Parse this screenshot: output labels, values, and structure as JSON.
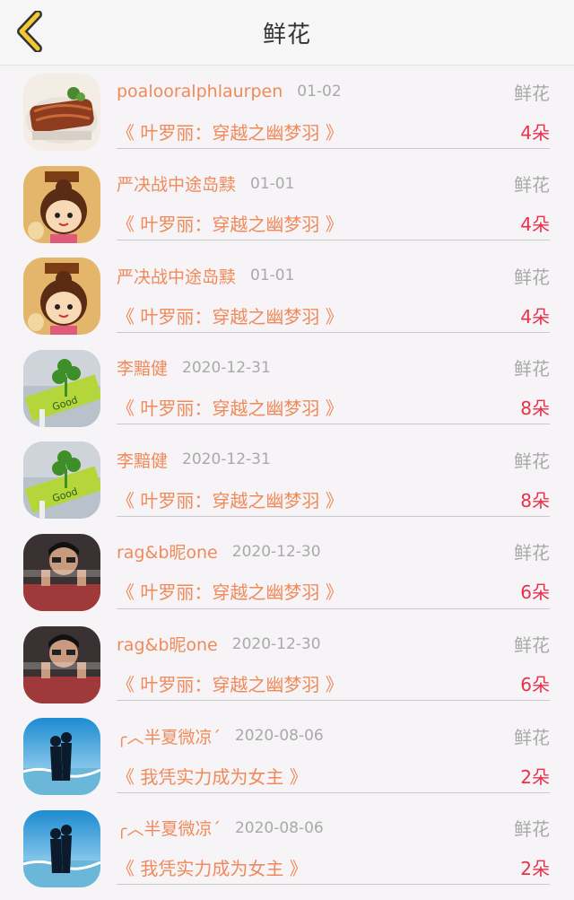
{
  "header": {
    "title": "鲜花",
    "back_icon": "chevron-left-icon",
    "accent": "#f3c832"
  },
  "colors": {
    "name": "#f08a5b",
    "date": "#a9a9a9",
    "count": "#e8304a"
  },
  "rows": [
    {
      "avatar": "food",
      "username": "poalooralphlaurpen",
      "date": "01-02",
      "type": "鲜花",
      "book": "《 叶罗丽：穿越之幽梦羽 》",
      "count": "4朵"
    },
    {
      "avatar": "cartoon-girl",
      "username": "严决战中途岛黩",
      "date": "01-01",
      "type": "鲜花",
      "book": "《 叶罗丽：穿越之幽梦羽 》",
      "count": "4朵"
    },
    {
      "avatar": "cartoon-girl",
      "username": "严决战中途岛黩",
      "date": "01-01",
      "type": "鲜花",
      "book": "《 叶罗丽：穿越之幽梦羽 》",
      "count": "4朵"
    },
    {
      "avatar": "clover",
      "username": "李黯健",
      "date": "2020-12-31",
      "type": "鲜花",
      "book": "《 叶罗丽：穿越之幽梦羽 》",
      "count": "8朵"
    },
    {
      "avatar": "clover",
      "username": "李黯健",
      "date": "2020-12-31",
      "type": "鲜花",
      "book": "《 叶罗丽：穿越之幽梦羽 》",
      "count": "8朵"
    },
    {
      "avatar": "boy",
      "username": "rag&b昵one",
      "date": "2020-12-30",
      "type": "鲜花",
      "book": "《 叶罗丽：穿越之幽梦羽 》",
      "count": "6朵"
    },
    {
      "avatar": "boy",
      "username": "rag&b昵one",
      "date": "2020-12-30",
      "type": "鲜花",
      "book": "《 叶罗丽：穿越之幽梦羽 》",
      "count": "6朵"
    },
    {
      "avatar": "couple",
      "username": "╭︿半夏微凉΄",
      "date": "2020-08-06",
      "type": "鲜花",
      "book": "《 我凭实力成为女主 》",
      "count": "2朵"
    },
    {
      "avatar": "couple",
      "username": "╭︿半夏微凉΄",
      "date": "2020-08-06",
      "type": "鲜花",
      "book": "《 我凭实力成为女主 》",
      "count": "2朵"
    }
  ]
}
